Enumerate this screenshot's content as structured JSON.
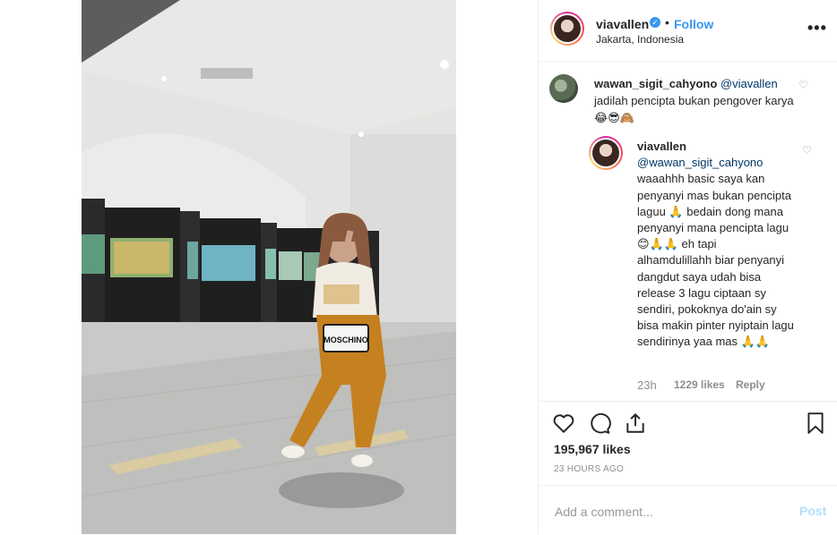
{
  "header": {
    "username": "viavallen",
    "verified_mark": "✓",
    "separator": "•",
    "follow_label": "Follow",
    "location": "Jakarta, Indonesia",
    "more_label": "•••"
  },
  "photo": {
    "bag_text": "MOSCHINO"
  },
  "comment": {
    "username": "wawan_sigit_cahyono",
    "mention": "@viavallen",
    "text": "jadilah pencipta bukan pengover karya 😂😎🙈"
  },
  "reply": {
    "username": "viavallen",
    "mention": "@wawan_sigit_cahyono",
    "text": "waaahhh basic saya kan penyanyi mas bukan pencipta laguu 🙏 bedain dong mana penyanyi mana pencipta lagu 😊🙏🙏 eh tapi alhamdulillahh biar penyanyi dangdut saya udah bisa release 3 lagu ciptaan sy sendiri, pokoknya do'ain sy bisa makin pinter nyiptain lagu sendirinya yaa mas 🙏🙏",
    "time": "23h",
    "likes": "1229 likes",
    "reply_label": "Reply"
  },
  "icons": {
    "heart": "heart-icon",
    "comment": "comment-icon",
    "share": "share-icon",
    "bookmark": "bookmark-icon"
  },
  "stats": {
    "likes": "195,967 likes",
    "posted": "23 HOURS AGO"
  },
  "add_comment": {
    "placeholder": "Add a comment...",
    "post_label": "Post"
  },
  "colors": {
    "link_blue": "#3897f0",
    "mention_blue": "#003569",
    "muted": "#8e8e8e"
  }
}
